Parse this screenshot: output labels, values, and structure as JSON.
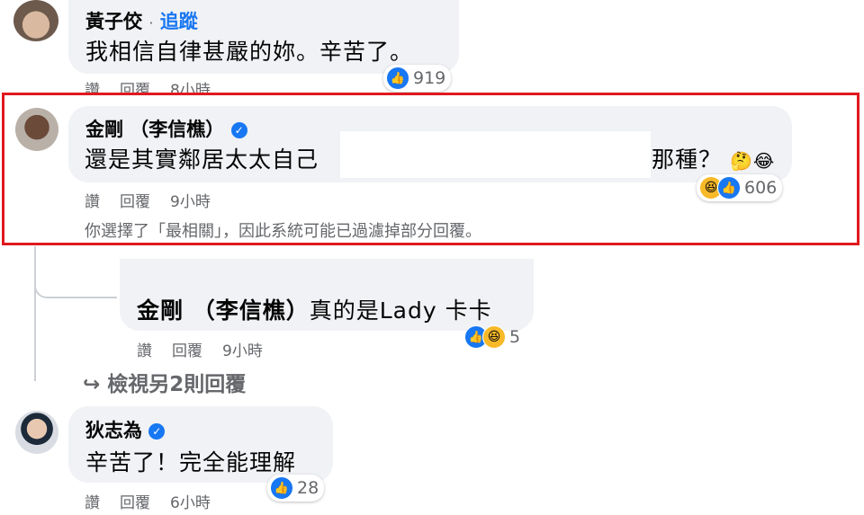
{
  "comments": [
    {
      "author": "黃子佼",
      "follow_sep": "·",
      "follow": "追蹤",
      "text": "我相信自律甚嚴的妳。辛苦了。",
      "actions": [
        "讚",
        "回覆",
        "8小時"
      ],
      "reaction_count": "919"
    },
    {
      "author": "金剛 （李信樵）",
      "text_before": "還是其實鄰居太太自己",
      "text_after": "那種？",
      "actions": [
        "讚",
        "回覆",
        "9小時"
      ],
      "reaction_count": "606",
      "filter_note": "你選擇了「最相關」，因此系統可能已過濾掉部分回覆。"
    }
  ],
  "reply": {
    "author": "金剛 （李信樵）",
    "text": "真的是Lady 卡卡",
    "actions": [
      "讚",
      "回覆",
      "9小時"
    ],
    "reaction_count": "5"
  },
  "view_more": "檢視另2則回覆",
  "last_comment": {
    "author": "狄志為",
    "text": "辛苦了！完全能理解",
    "actions": [
      "讚",
      "回覆",
      "6小時"
    ],
    "reaction_count": "28"
  },
  "colors": {
    "highlight_border": "#e0191f",
    "like_blue": "#1877f2",
    "bubble": "#f0f2f5"
  },
  "icons": {
    "like": "thumbs-up-icon",
    "haha": "laughing-face-icon",
    "verified": "verified-badge-icon"
  }
}
